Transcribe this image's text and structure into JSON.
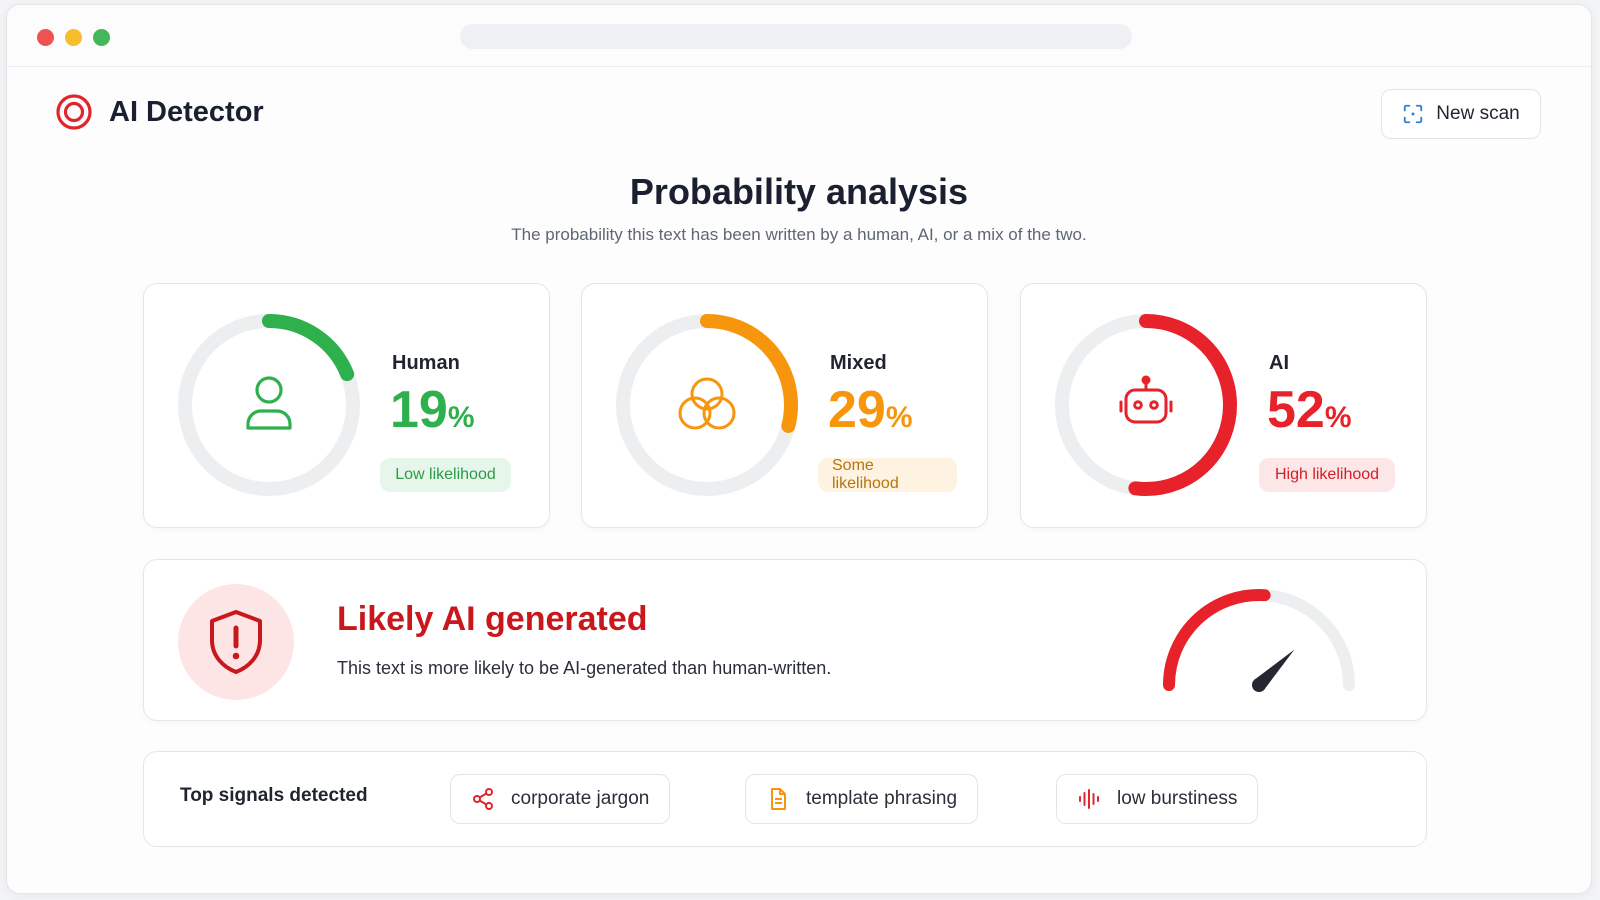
{
  "app": {
    "name": "AI Detector"
  },
  "header": {
    "new_scan_label": "New scan"
  },
  "main": {
    "title": "Probability analysis",
    "subtitle": "The probability this text has been written by a human, AI, or a mix of the two."
  },
  "cards": [
    {
      "label": "Human",
      "value": "19",
      "value_fraction": 0.19,
      "unit": "%",
      "badge": "Low likelihood",
      "color": "#2eb04d",
      "icon": "person-icon"
    },
    {
      "label": "Mixed",
      "value": "29",
      "value_fraction": 0.29,
      "unit": "%",
      "badge": "Some likelihood",
      "color": "#f7950d",
      "icon": "overlapping-circles-icon"
    },
    {
      "label": "AI",
      "value": "52",
      "value_fraction": 0.52,
      "unit": "%",
      "badge": "High likelihood",
      "color": "#e8222a",
      "icon": "robot-icon"
    }
  ],
  "verdict": {
    "title": "Likely AI generated",
    "description": "This text is more likely to be AI-generated than human-written.",
    "gauge_level": 0.52,
    "color": "#e8222a"
  },
  "signals": {
    "title": "Top signals detected",
    "items": [
      {
        "label": "corporate jargon",
        "icon": "share-nodes-icon"
      },
      {
        "label": "template phrasing",
        "icon": "document-icon"
      },
      {
        "label": "low burstiness",
        "icon": "waveform-icon"
      }
    ]
  }
}
